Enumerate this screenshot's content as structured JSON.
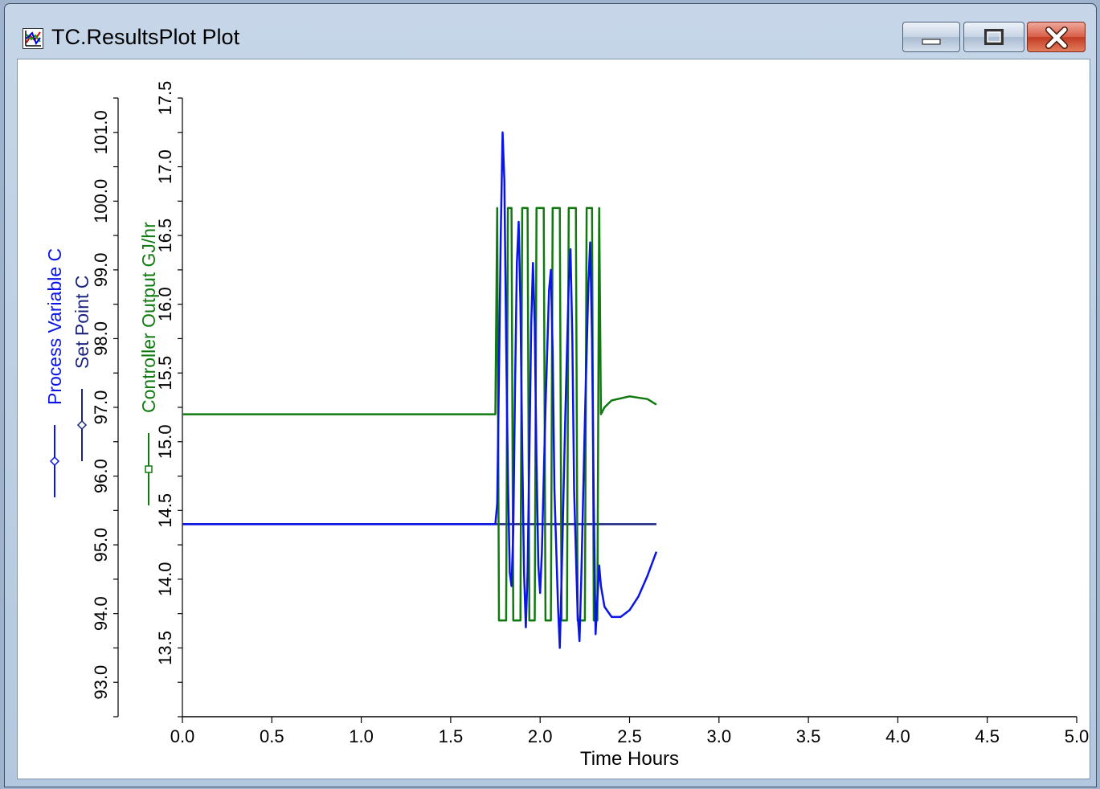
{
  "window": {
    "title": "TC.ResultsPlot Plot"
  },
  "chart_data": {
    "type": "line",
    "xlabel": "Time Hours",
    "x_ticks": [
      "0.0",
      "0.5",
      "1.0",
      "1.5",
      "2.0",
      "2.5",
      "3.0",
      "3.5",
      "4.0",
      "4.5",
      "5.0"
    ],
    "xlim": [
      0,
      5
    ],
    "axes": [
      {
        "label": "Process Variable C",
        "ylim": [
          92.5,
          101.5
        ],
        "ticks": [
          "93.0",
          "94.0",
          "95.0",
          "96.0",
          "97.0",
          "98.0",
          "99.0",
          "100.0",
          "101.0"
        ]
      },
      {
        "label": "Set Point C",
        "ylim": [
          92.5,
          101.5
        ],
        "shares_axis_with": "Process Variable C"
      },
      {
        "label": "Controller Output GJ/hr",
        "ylim": [
          13.0,
          17.5
        ],
        "ticks": [
          "13.5",
          "14.0",
          "14.5",
          "15.0",
          "15.5",
          "16.0",
          "16.5",
          "17.0",
          "17.5"
        ]
      }
    ],
    "series": [
      {
        "name": "Set Point C",
        "color": "#1a237e",
        "axis": 0,
        "marker": "diamond",
        "points": [
          [
            0,
            95.3
          ],
          [
            2.65,
            95.3
          ]
        ]
      },
      {
        "name": "Controller Output GJ/hr",
        "color": "#107a10",
        "axis": 1,
        "marker": "square",
        "points": [
          [
            0,
            15.2
          ],
          [
            1.75,
            15.2
          ],
          [
            1.76,
            16.7
          ],
          [
            1.77,
            13.7
          ],
          [
            1.81,
            13.7
          ],
          [
            1.82,
            16.7
          ],
          [
            1.84,
            16.7
          ],
          [
            1.85,
            13.7
          ],
          [
            1.89,
            13.7
          ],
          [
            1.9,
            16.7
          ],
          [
            1.93,
            16.7
          ],
          [
            1.94,
            13.7
          ],
          [
            1.97,
            13.7
          ],
          [
            1.98,
            16.7
          ],
          [
            2.02,
            16.7
          ],
          [
            2.03,
            13.7
          ],
          [
            2.06,
            13.7
          ],
          [
            2.07,
            16.7
          ],
          [
            2.11,
            16.7
          ],
          [
            2.12,
            13.7
          ],
          [
            2.15,
            13.7
          ],
          [
            2.16,
            16.7
          ],
          [
            2.2,
            16.7
          ],
          [
            2.21,
            13.7
          ],
          [
            2.25,
            13.7
          ],
          [
            2.26,
            16.7
          ],
          [
            2.29,
            16.7
          ],
          [
            2.3,
            13.7
          ],
          [
            2.32,
            13.7
          ],
          [
            2.33,
            16.7
          ],
          [
            2.34,
            15.2
          ],
          [
            2.36,
            15.25
          ],
          [
            2.4,
            15.3
          ],
          [
            2.5,
            15.33
          ],
          [
            2.6,
            15.31
          ],
          [
            2.65,
            15.27
          ]
        ]
      },
      {
        "name": "Process Variable C",
        "color": "#0a14e6",
        "axis": 0,
        "marker": "circle",
        "points": [
          [
            0,
            95.3
          ],
          [
            1.75,
            95.3
          ],
          [
            1.76,
            95.6
          ],
          [
            1.77,
            97.5
          ],
          [
            1.78,
            99.5
          ],
          [
            1.79,
            101.0
          ],
          [
            1.8,
            100.3
          ],
          [
            1.81,
            98.0
          ],
          [
            1.82,
            96.0
          ],
          [
            1.83,
            94.6
          ],
          [
            1.84,
            94.4
          ],
          [
            1.85,
            95.2
          ],
          [
            1.86,
            97.3
          ],
          [
            1.87,
            99.1
          ],
          [
            1.88,
            99.7
          ],
          [
            1.89,
            98.5
          ],
          [
            1.9,
            96.4
          ],
          [
            1.91,
            94.6
          ],
          [
            1.92,
            93.8
          ],
          [
            1.93,
            94.6
          ],
          [
            1.94,
            96.3
          ],
          [
            1.95,
            98.2
          ],
          [
            1.96,
            99.1
          ],
          [
            1.97,
            98.2
          ],
          [
            1.98,
            96.2
          ],
          [
            1.99,
            94.7
          ],
          [
            2.0,
            94.3
          ],
          [
            2.01,
            94.9
          ],
          [
            2.03,
            97.0
          ],
          [
            2.05,
            98.7
          ],
          [
            2.06,
            99.0
          ],
          [
            2.07,
            97.8
          ],
          [
            2.08,
            95.8
          ],
          [
            2.1,
            94.1
          ],
          [
            2.11,
            93.5
          ],
          [
            2.12,
            94.5
          ],
          [
            2.14,
            96.8
          ],
          [
            2.16,
            98.8
          ],
          [
            2.17,
            99.3
          ],
          [
            2.18,
            98.0
          ],
          [
            2.19,
            95.8
          ],
          [
            2.21,
            94.0
          ],
          [
            2.22,
            93.6
          ],
          [
            2.23,
            94.5
          ],
          [
            2.25,
            96.8
          ],
          [
            2.27,
            98.8
          ],
          [
            2.28,
            99.4
          ],
          [
            2.29,
            98.0
          ],
          [
            2.3,
            95.6
          ],
          [
            2.31,
            93.7
          ],
          [
            2.32,
            94.2
          ],
          [
            2.33,
            94.7
          ],
          [
            2.34,
            94.4
          ],
          [
            2.36,
            94.1
          ],
          [
            2.4,
            93.95
          ],
          [
            2.45,
            93.95
          ],
          [
            2.5,
            94.05
          ],
          [
            2.55,
            94.25
          ],
          [
            2.6,
            94.55
          ],
          [
            2.65,
            94.9
          ]
        ]
      }
    ]
  }
}
